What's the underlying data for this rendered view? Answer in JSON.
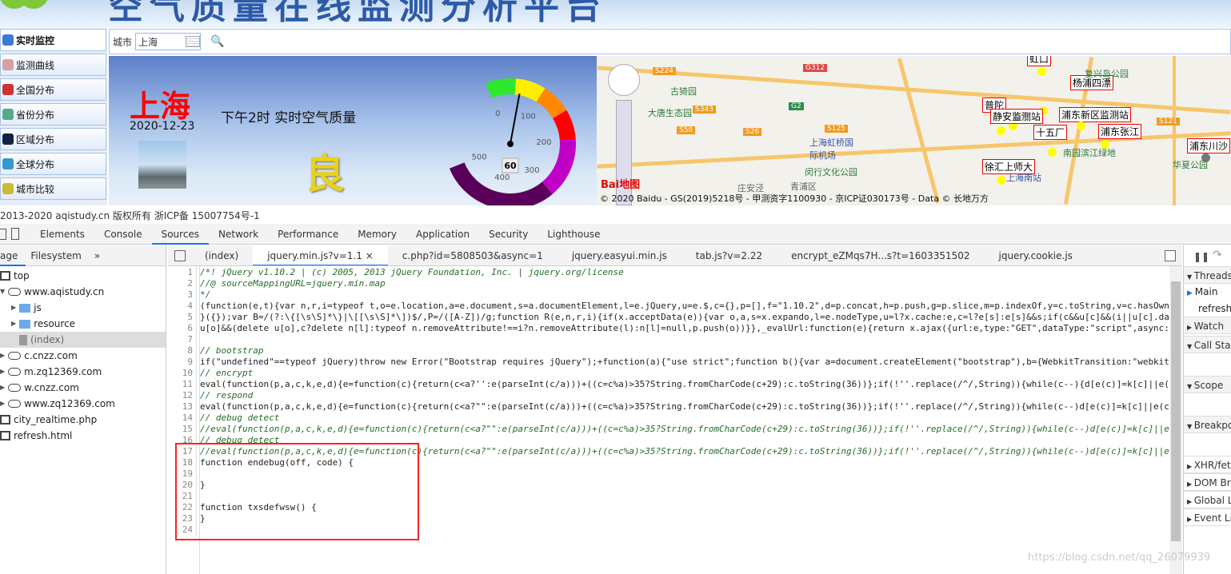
{
  "site": {
    "title": "空气质量在线监测分析平台",
    "footer": "2013-2020 aqistudy.cn 版权所有 浙ICP备 15007754号-1"
  },
  "nav": [
    {
      "label": "实时监控",
      "active": true,
      "icon": "monitor-icon"
    },
    {
      "label": "监测曲线",
      "icon": "chart-icon"
    },
    {
      "label": "全国分布",
      "icon": "map-pin-icon"
    },
    {
      "label": "省份分布",
      "icon": "province-map-icon"
    },
    {
      "label": "区域分布",
      "icon": "region-icon"
    },
    {
      "label": "全球分布",
      "icon": "globe-icon"
    },
    {
      "label": "城市比较",
      "icon": "scale-icon"
    }
  ],
  "search": {
    "label": "城市",
    "value": "上海"
  },
  "banner": {
    "city": "上海",
    "date": "2020-12-23",
    "label": "下午2时 实时空气质量",
    "level": "良",
    "aqi": "60",
    "gauge_ticks": [
      "0",
      "100",
      "200",
      "300",
      "400",
      "500"
    ],
    "gauge_value": 60
  },
  "map": {
    "stations": [
      "虹口",
      "杨浦四漂",
      "普陀",
      "静安监测站",
      "浦东新区监测站",
      "十五厂",
      "浦东张江",
      "浦东川沙",
      "徐汇上师大"
    ],
    "places": [
      "复兴岛公园",
      "古猗园",
      "大唐生态园",
      "上海虹桥国际机场",
      "南园滨江绿地",
      "华夏公园",
      "闵行文化公园",
      "上海南站",
      "青浦区",
      "庄安泾",
      "海市"
    ],
    "roads": [
      "S224",
      "G312",
      "G2",
      "S343",
      "S58",
      "S26",
      "S125",
      "S121"
    ],
    "copyright": "© 2020 Baidu - GS(2019)5218号 - 甲测资字1100930 - 京ICP证030173号 - Data © 长地万方",
    "logo": "Bai地图"
  },
  "devtools": {
    "tabs": [
      "Elements",
      "Console",
      "Sources",
      "Network",
      "Performance",
      "Memory",
      "Application",
      "Security",
      "Lighthouse"
    ],
    "active_tab": "Sources",
    "nav_tabs": [
      "age",
      "Filesystem",
      "»"
    ],
    "tree": [
      "top",
      "www.aqistudy.cn",
      "js",
      "resource",
      "(index)",
      "c.cnzz.com",
      "m.zq12369.com",
      "w.cnzz.com",
      "www.zq12369.com",
      "city_realtime.php",
      "refresh.html"
    ],
    "editor_tabs": [
      "(index)",
      "jquery.min.js?v=1.1",
      "c.php?id=5808503&async=1",
      "jquery.easyui.min.js",
      "tab.js?v=2.22",
      "encrypt_eZMqs7H...s?t=1603351502",
      "jquery.cookie.js"
    ],
    "active_editor_tab": "jquery.min.js?v=1.1",
    "code": [
      {
        "t": "c",
        "s": "/*! jQuery v1.10.2 | (c) 2005, 2013 jQuery Foundation, Inc. | jquery.org/license"
      },
      {
        "t": "c",
        "s": "//@ sourceMappingURL=jquery.min.map"
      },
      {
        "t": "c",
        "s": "*/"
      },
      {
        "t": "k",
        "s": "(function(e,t){var n,r,i=typeof t,o=e.location,a=e.document,s=a.documentElement,l=e.jQuery,u=e.$,c={},p=[],f=\"1.10.2\",d=p.concat,h=p.push,g=p.slice,m=p.indexOf,y=c.toString,v=c.hasOwn"
      },
      {
        "t": "k",
        "s": "}({});var B=/(?:\\{[\\s\\S]*\\}|\\[[\\s\\S]*\\])$/,P=/([A-Z])/g;function R(e,n,r,i){if(x.acceptData(e)){var o,a,s=x.expando,l=e.nodeType,u=l?x.cache:e,c=l?e[s]:e[s]&&s;if(c&&u[c]&&(i||u[c].da"
      },
      {
        "t": "k",
        "s": "u[o]&&(delete u[o],c?delete n[l]:typeof n.removeAttribute!==i?n.removeAttribute(l):n[l]=null,p.push(o))}},_evalUrl:function(e){return x.ajax({url:e,type:\"GET\",dataType:\"script\",async:"
      },
      {
        "t": "k",
        "s": ""
      },
      {
        "t": "c",
        "s": "// bootstrap"
      },
      {
        "t": "k",
        "s": "if(\"undefined\"==typeof jQuery)throw new Error(\"Bootstrap requires jQuery\");+function(a){\"use strict\";function b(){var a=document.createElement(\"bootstrap\"),b={WebkitTransition:\"webkit"
      },
      {
        "t": "c",
        "s": "// encrypt"
      },
      {
        "t": "k",
        "s": "eval(function(p,a,c,k,e,d){e=function(c){return(c<a?'':e(parseInt(c/a)))+((c=c%a)>35?String.fromCharCode(c+29):c.toString(36))};if(!''.replace(/^/,String)){while(c--){d[e(c)]=k[c]||e("
      },
      {
        "t": "c",
        "s": "// respond"
      },
      {
        "t": "k",
        "s": "eval(function(p,a,c,k,e,d){e=function(c){return(c<a?\"\":e(parseInt(c/a)))+((c=c%a)>35?String.fromCharCode(c+29):c.toString(36))};if(!''.replace(/^/,String)){while(c--)d[e(c)]=k[c]||e(c"
      },
      {
        "t": "c",
        "s": "// debug detect"
      },
      {
        "t": "c",
        "s": "//eval(function(p,a,c,k,e,d){e=function(c){return(c<a?\"\":e(parseInt(c/a)))+((c=c%a)>35?String.fromCharCode(c+29):c.toString(36))};if(!''.replace(/^/,String)){while(c--)d[e(c)]=k[c]||e"
      },
      {
        "t": "c",
        "s": "// debug detect"
      },
      {
        "t": "c",
        "s": "//eval(function(p,a,c,k,e,d){e=function(c){return(c<a?\"\":e(parseInt(c/a)))+((c=c%a)>35?String.fromCharCode(c+29):c.toString(36))};if(!''.replace(/^/,String)){while(c--)d[e(c)]=k[c]||e"
      },
      {
        "t": "k",
        "s": "function endebug(off, code) {"
      },
      {
        "t": "k",
        "s": ""
      },
      {
        "t": "k",
        "s": "}"
      },
      {
        "t": "k",
        "s": ""
      },
      {
        "t": "k",
        "s": "function txsdefwsw() {"
      },
      {
        "t": "k",
        "s": "}"
      },
      {
        "t": "k",
        "s": ""
      }
    ],
    "right_sections": [
      "Threads",
      "Watch",
      "Call Stack",
      "Scope",
      "Breakpoints",
      "XHR/fetch",
      "DOM Br",
      "Global L",
      "Event Li"
    ],
    "thread_items": [
      "Main",
      "refresh."
    ]
  },
  "watermark": "https://blog.csdn.net/qq_26079939",
  "colors": {
    "accent": "#1a73e8",
    "highlight_box": "#ff2222",
    "comment": "#236e25",
    "city": "#ff0000",
    "level": "#e8d21f"
  }
}
